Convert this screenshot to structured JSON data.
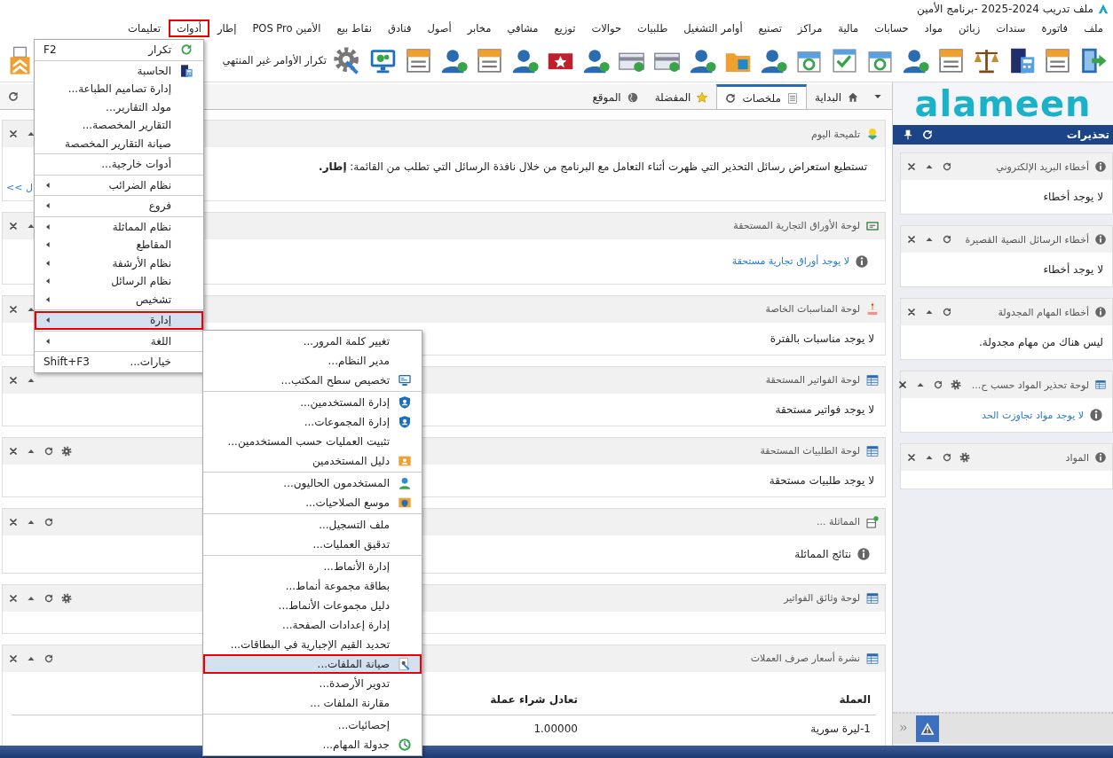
{
  "window": {
    "title": "ملف تدريب 2024-2025 -برنامج الأمين"
  },
  "menu_bar": [
    {
      "label": "ملف",
      "selected": false
    },
    {
      "label": "فاتورة",
      "selected": false
    },
    {
      "label": "سندات",
      "selected": false
    },
    {
      "label": "زبائن",
      "selected": false
    },
    {
      "label": "مواد",
      "selected": false
    },
    {
      "label": "حسابات",
      "selected": false
    },
    {
      "label": "مالية",
      "selected": false
    },
    {
      "label": "مراكز",
      "selected": false
    },
    {
      "label": "تصنيع",
      "selected": false
    },
    {
      "label": "أوامر التشغيل",
      "selected": false
    },
    {
      "label": "طلبيات",
      "selected": false
    },
    {
      "label": "حوالات",
      "selected": false
    },
    {
      "label": "توزيع",
      "selected": false
    },
    {
      "label": "مشافي",
      "selected": false
    },
    {
      "label": "مخابر",
      "selected": false
    },
    {
      "label": "أصول",
      "selected": false
    },
    {
      "label": "فنادق",
      "selected": false
    },
    {
      "label": "نقاط بيع",
      "selected": false
    },
    {
      "label": "الأمين POS Pro",
      "selected": false
    },
    {
      "label": "إطار",
      "selected": false
    },
    {
      "label": "أدوات",
      "selected": true
    },
    {
      "label": "تعليمات",
      "selected": false
    }
  ],
  "toolbar": {
    "label": "تكرار الأوامر غير المنتهي"
  },
  "tabs": [
    {
      "label": "البداية",
      "selected": false
    },
    {
      "label": "ملخصات",
      "selected": true
    },
    {
      "label": "المفضلة",
      "selected": false
    },
    {
      "label": "الموقع",
      "selected": false
    }
  ],
  "panels": [
    {
      "title": "تلميحة اليوم",
      "refresh": false,
      "settings": false,
      "body": {
        "kind": "tip",
        "text": "تستطيع استعراض رسائل التحذير التي ظهرت أثناء التعامل مع البرنامج من خلال نافذة الرسائل التي تطلب من القائمة: **إطار.**",
        "link": "<< ل"
      }
    },
    {
      "title": "لوحة الأوراق التجارية المستحقة",
      "refresh": false,
      "settings": false,
      "body": {
        "kind": "info-link",
        "text": "لا يوجد أوراق تجارية مستحقة"
      }
    },
    {
      "title": "لوحة المناسبات الخاصة",
      "refresh": false,
      "settings": false,
      "body": {
        "kind": "text",
        "text": "لا يوجد مناسبات بالفترة"
      }
    },
    {
      "title": "لوحة الفواتير المستحقة",
      "refresh": false,
      "settings": false,
      "body": {
        "kind": "text",
        "text": "لا يوجد فواتير مستحقة"
      }
    },
    {
      "title": "لوحة الطلبيات المستحقة",
      "refresh": true,
      "settings": true,
      "body": {
        "kind": "text",
        "text": "لا يوجد طلبيات مستحقة"
      }
    },
    {
      "title": "المماثلة ...",
      "refresh": true,
      "settings": false,
      "body": {
        "kind": "info",
        "text": "نتائج المماثلة"
      }
    },
    {
      "title": "لوحة وثائق الفواتير",
      "refresh": true,
      "settings": true,
      "body": {
        "kind": "empty"
      }
    },
    {
      "title": "نشرة أسعار صرف العملات",
      "refresh": true,
      "settings": false,
      "body": {
        "kind": "table",
        "columns": [
          "العملة",
          "تعادل شراء عملة"
        ],
        "rows": [
          [
            "1-ليرة سورية",
            "1.00000"
          ]
        ]
      }
    }
  ],
  "sidebar": {
    "logo": "alameen",
    "title": "تحذيرات",
    "cards": [
      {
        "title": "أخطاء البريد الإلكتروني",
        "settings": false,
        "body": {
          "kind": "text",
          "text": "لا يوجد أخطاء"
        }
      },
      {
        "title": "أخطاء الرسائل النصية القصيرة",
        "settings": false,
        "body": {
          "kind": "text",
          "text": "لا يوجد أخطاء"
        }
      },
      {
        "title": "أخطاء المهام المجدولة",
        "settings": false,
        "body": {
          "kind": "text",
          "text": "ليس هناك من مهام مجدولة."
        }
      },
      {
        "title": "لوحة تحذير المواد حسب ح...",
        "settings": true,
        "body": {
          "kind": "info-link",
          "text": "لا يوجد مواد تجاوزت الحد"
        }
      },
      {
        "title": "المواد",
        "settings": true,
        "body": {
          "kind": "empty"
        }
      }
    ]
  },
  "tools_menu": {
    "items": [
      {
        "kind": "item",
        "label": "تكرار",
        "shortcut": "F2",
        "selected": false
      },
      {
        "kind": "separator"
      },
      {
        "kind": "item",
        "label": "الحاسبة",
        "selected": false
      },
      {
        "kind": "item",
        "label": "إدارة تصاميم الطباعة...",
        "selected": false
      },
      {
        "kind": "item",
        "label": "مولد التقارير...",
        "selected": false
      },
      {
        "kind": "item",
        "label": "التقارير المخصصة...",
        "selected": false
      },
      {
        "kind": "item",
        "label": "صيانة التقارير المخصصة",
        "selected": false
      },
      {
        "kind": "separator"
      },
      {
        "kind": "item",
        "label": "أدوات خارجية...",
        "selected": false
      },
      {
        "kind": "separator"
      },
      {
        "kind": "submenu",
        "label": "نظام الضرائب",
        "selected": false
      },
      {
        "kind": "separator"
      },
      {
        "kind": "submenu",
        "label": "فروع",
        "selected": false
      },
      {
        "kind": "separator"
      },
      {
        "kind": "submenu",
        "label": "نظام المماثلة",
        "selected": false
      },
      {
        "kind": "submenu",
        "label": "المقاطع",
        "selected": false
      },
      {
        "kind": "submenu",
        "label": "نظام الأرشفة",
        "selected": false
      },
      {
        "kind": "submenu",
        "label": "نظام الرسائل",
        "selected": false
      },
      {
        "kind": "submenu",
        "label": "تشخيص",
        "selected": false
      },
      {
        "kind": "separator"
      },
      {
        "kind": "submenu",
        "label": "إدارة",
        "selected": true
      },
      {
        "kind": "separator"
      },
      {
        "kind": "submenu",
        "label": "اللغة",
        "selected": false
      },
      {
        "kind": "separator"
      },
      {
        "kind": "item",
        "label": "خيارات...",
        "shortcut": "Shift+F3",
        "selected": false
      }
    ]
  },
  "admin_submenu": {
    "items": [
      {
        "kind": "item",
        "label": "تغيير كلمة المرور...",
        "selected": false
      },
      {
        "kind": "item",
        "label": "مدير النظام...",
        "selected": false
      },
      {
        "kind": "item",
        "label": "تخصيص سطح المكتب...",
        "selected": false
      },
      {
        "kind": "separator"
      },
      {
        "kind": "item",
        "label": "إدارة المستخدمين...",
        "selected": false
      },
      {
        "kind": "item",
        "label": "إدارة المجموعات...",
        "selected": false
      },
      {
        "kind": "item",
        "label": "تثبيت العمليات حسب المستخدمين...",
        "selected": false
      },
      {
        "kind": "item",
        "label": "دليل المستخدمين",
        "selected": false
      },
      {
        "kind": "separator"
      },
      {
        "kind": "item",
        "label": "المستخدمون الحاليون...",
        "selected": false
      },
      {
        "kind": "item",
        "label": "موسع الصلاحيات...",
        "selected": false
      },
      {
        "kind": "separator"
      },
      {
        "kind": "item",
        "label": "ملف التسجيل...",
        "selected": false
      },
      {
        "kind": "item",
        "label": "تدقيق العمليات...",
        "selected": false
      },
      {
        "kind": "separator"
      },
      {
        "kind": "item",
        "label": "إدارة الأنماط...",
        "selected": false
      },
      {
        "kind": "item",
        "label": "بطاقة مجموعة أنماط...",
        "selected": false
      },
      {
        "kind": "item",
        "label": "دليل مجموعات الأنماط...",
        "selected": false
      },
      {
        "kind": "item",
        "label": "إدارة إعدادات الصفحة...",
        "selected": false
      },
      {
        "kind": "item",
        "label": "تحديد القيم الإجبارية في البطاقات...",
        "selected": false
      },
      {
        "kind": "item",
        "label": "صيانة الملفات...",
        "selected": true
      },
      {
        "kind": "item",
        "label": "تدوير الأرصدة...",
        "selected": false
      },
      {
        "kind": "item",
        "label": "مقارنة الملفات ...",
        "selected": false
      },
      {
        "kind": "separator"
      },
      {
        "kind": "item",
        "label": "إحصائيات...",
        "selected": false
      },
      {
        "kind": "item",
        "label": "جدولة المهام...",
        "selected": false
      }
    ]
  }
}
